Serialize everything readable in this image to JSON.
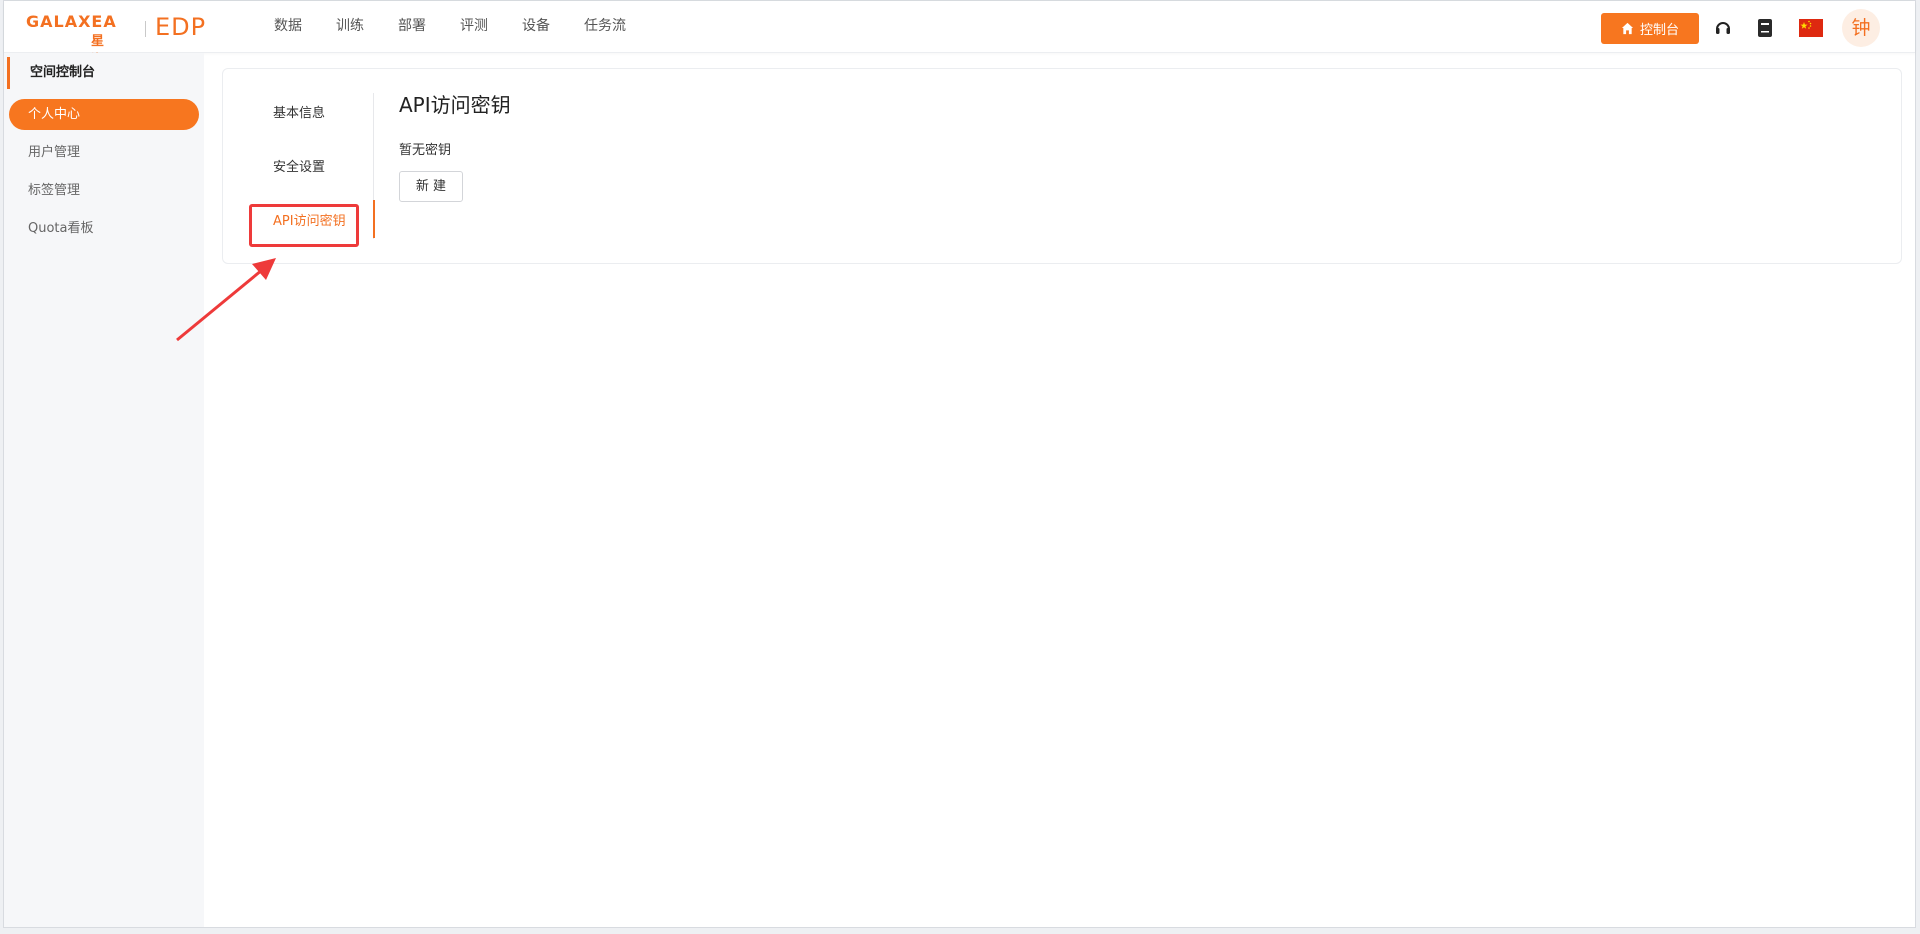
{
  "header": {
    "logo_brand": "GALAXEA",
    "logo_sub": "星海图",
    "logo_product": "EDP",
    "nav": [
      "数据",
      "训练",
      "部署",
      "评测",
      "设备",
      "任务流"
    ],
    "console_button": "控制台",
    "icons": [
      "headset-icon",
      "book-icon",
      "china-flag-icon"
    ],
    "avatar_text": "钟"
  },
  "sidebar": {
    "title": "空间控制台",
    "items": [
      {
        "label": "个人中心",
        "active": true
      },
      {
        "label": "用户管理",
        "active": false
      },
      {
        "label": "标签管理",
        "active": false
      },
      {
        "label": "Quota看板",
        "active": false
      }
    ]
  },
  "main": {
    "tabs": [
      {
        "label": "基本信息",
        "active": false
      },
      {
        "label": "安全设置",
        "active": false
      },
      {
        "label": "API访问密钥",
        "active": true
      }
    ],
    "title": "API访问密钥",
    "empty_text": "暂无密钥",
    "new_button": "新 建"
  },
  "colors": {
    "accent": "#f37021",
    "annotation": "#ee3a3a"
  }
}
